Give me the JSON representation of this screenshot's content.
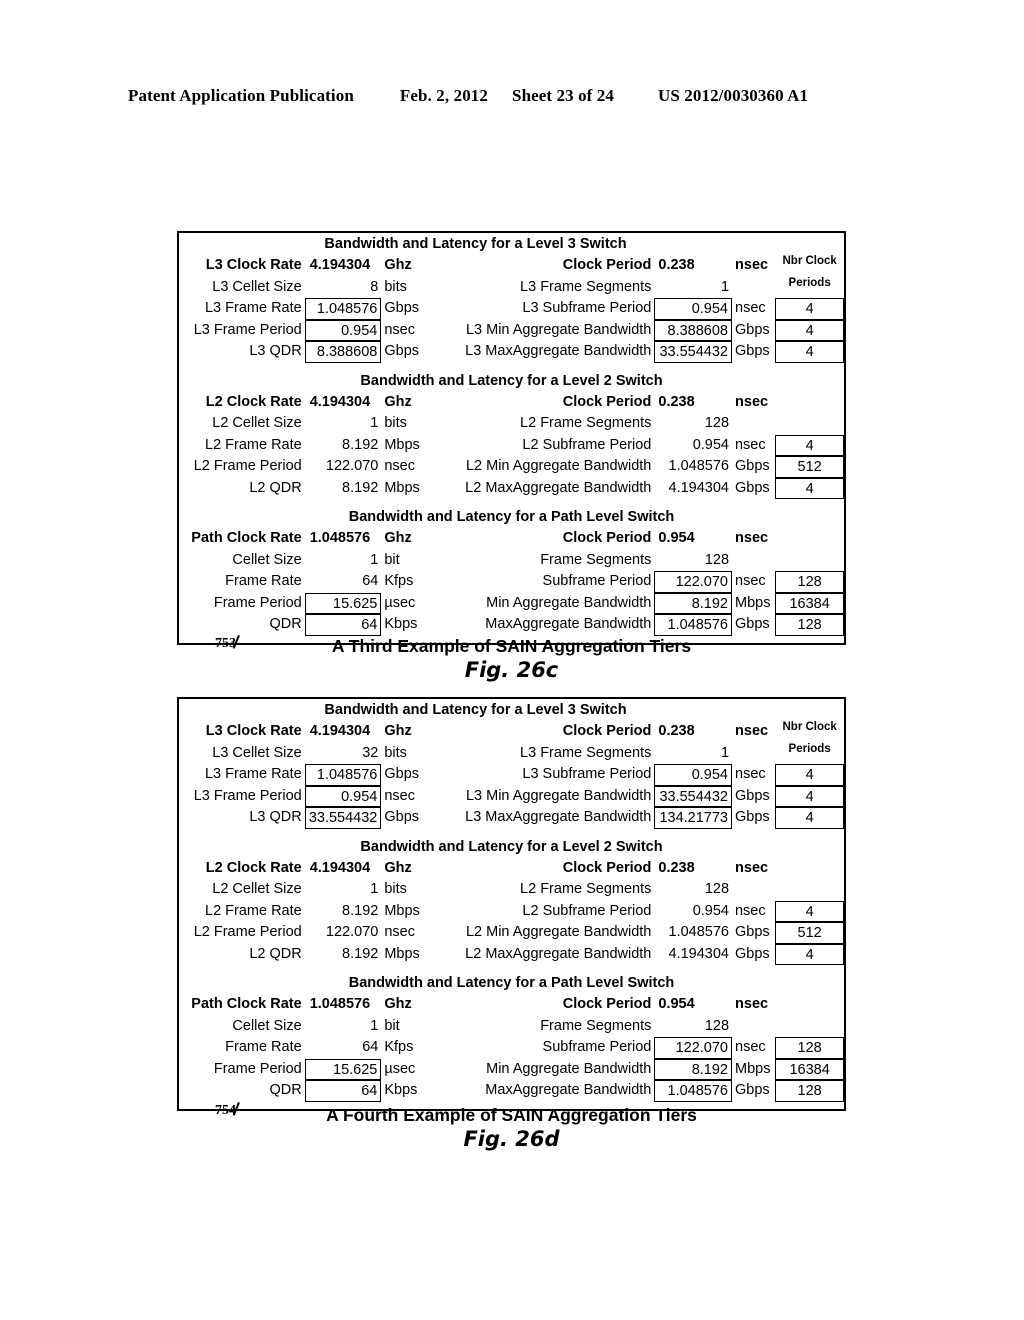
{
  "header": {
    "publication": "Patent Application Publication",
    "date": "Feb. 2, 2012",
    "sheet": "Sheet 23 of 24",
    "number": "US 2012/0030360 A1"
  },
  "nbr_clock_header": {
    "line1": "Nbr Clock",
    "line2": "Periods"
  },
  "figures": [
    {
      "id": "fig-26c",
      "ref_numeral": "753",
      "caption": "A Third Example of SAIN Aggregation Tiers",
      "fig_label": "Fig. 26c",
      "sections": [
        {
          "title": "Bandwidth and Latency for a Level 3 Switch",
          "clock_rate_label": "L3 Clock Rate",
          "clock_rate_value": "4.194304",
          "clock_rate_unit": "Ghz",
          "clock_period_label": "Clock Period",
          "clock_period_value": "0.238",
          "clock_period_unit": "nsec",
          "rows": [
            {
              "left_label": "L3 Cellet Size",
              "left_value": "8",
              "left_unit": "bits",
              "left_boxed": false,
              "right_label": "L3 Frame Segments",
              "right_value": "1",
              "right_unit": "",
              "right_boxed": false,
              "clock": ""
            },
            {
              "left_label": "L3 Frame Rate",
              "left_value": "1.048576",
              "left_unit": "Gbps",
              "left_boxed": true,
              "right_label": "L3 Subframe Period",
              "right_value": "0.954",
              "right_unit": "nsec",
              "right_boxed": true,
              "clock": "4"
            },
            {
              "left_label": "L3 Frame Period",
              "left_value": "0.954",
              "left_unit": "nsec",
              "left_boxed": true,
              "right_label": "L3 Min Aggregate Bandwidth",
              "right_value": "8.388608",
              "right_unit": "Gbps",
              "right_boxed": true,
              "clock": "4"
            },
            {
              "left_label": "L3 QDR",
              "left_value": "8.388608",
              "left_unit": "Gbps",
              "left_boxed": true,
              "right_label": "L3 MaxAggregate Bandwidth",
              "right_value": "33.554432",
              "right_unit": "Gbps",
              "right_boxed": true,
              "clock": "4"
            }
          ]
        },
        {
          "title": "Bandwidth and Latency for a Level 2 Switch",
          "clock_rate_label": "L2 Clock Rate",
          "clock_rate_value": "4.194304",
          "clock_rate_unit": "Ghz",
          "clock_period_label": "Clock Period",
          "clock_period_value": "0.238",
          "clock_period_unit": "nsec",
          "rows": [
            {
              "left_label": "L2 Cellet Size",
              "left_value": "1",
              "left_unit": "bits",
              "left_boxed": false,
              "right_label": "L2 Frame Segments",
              "right_value": "128",
              "right_unit": "",
              "right_boxed": false,
              "clock": ""
            },
            {
              "left_label": "L2 Frame Rate",
              "left_value": "8.192",
              "left_unit": "Mbps",
              "left_boxed": false,
              "right_label": "L2 Subframe Period",
              "right_value": "0.954",
              "right_unit": "nsec",
              "right_boxed": false,
              "clock": "4"
            },
            {
              "left_label": "L2 Frame Period",
              "left_value": "122.070",
              "left_unit": "nsec",
              "left_boxed": false,
              "right_label": "L2 Min Aggregate Bandwidth",
              "right_value": "1.048576",
              "right_unit": "Gbps",
              "right_boxed": false,
              "clock": "512"
            },
            {
              "left_label": "L2 QDR",
              "left_value": "8.192",
              "left_unit": "Mbps",
              "left_boxed": false,
              "right_label": "L2 MaxAggregate Bandwidth",
              "right_value": "4.194304",
              "right_unit": "Gbps",
              "right_boxed": false,
              "clock": "4"
            }
          ]
        },
        {
          "title": "Bandwidth and Latency for a Path Level Switch",
          "clock_rate_label": "Path Clock Rate",
          "clock_rate_value": "1.048576",
          "clock_rate_unit": "Ghz",
          "clock_period_label": "Clock Period",
          "clock_period_value": "0.954",
          "clock_period_unit": "nsec",
          "rows": [
            {
              "left_label": "Cellet Size",
              "left_value": "1",
              "left_unit": "bit",
              "left_boxed": false,
              "right_label": "Frame Segments",
              "right_value": "128",
              "right_unit": "",
              "right_boxed": false,
              "clock": ""
            },
            {
              "left_label": "Frame Rate",
              "left_value": "64",
              "left_unit": "Kfps",
              "left_boxed": false,
              "right_label": "Subframe Period",
              "right_value": "122.070",
              "right_unit": "nsec",
              "right_boxed": true,
              "clock": "128"
            },
            {
              "left_label": "Frame Period",
              "left_value": "15.625",
              "left_unit": "µsec",
              "left_boxed": true,
              "right_label": "Min Aggregate Bandwidth",
              "right_value": "8.192",
              "right_unit": "Mbps",
              "right_boxed": true,
              "clock": "16384"
            },
            {
              "left_label": "QDR",
              "left_value": "64",
              "left_unit": "Kbps",
              "left_boxed": true,
              "right_label": "MaxAggregate Bandwidth",
              "right_value": "1.048576",
              "right_unit": "Gbps",
              "right_boxed": true,
              "clock": "128"
            }
          ]
        }
      ]
    },
    {
      "id": "fig-26d",
      "ref_numeral": "754",
      "caption": "A Fourth Example of SAIN Aggregation Tiers",
      "fig_label": "Fig. 26d",
      "sections": [
        {
          "title": "Bandwidth and Latency for a Level 3 Switch",
          "clock_rate_label": "L3 Clock Rate",
          "clock_rate_value": "4.194304",
          "clock_rate_unit": "Ghz",
          "clock_period_label": "Clock Period",
          "clock_period_value": "0.238",
          "clock_period_unit": "nsec",
          "rows": [
            {
              "left_label": "L3 Cellet Size",
              "left_value": "32",
              "left_unit": "bits",
              "left_boxed": false,
              "right_label": "L3 Frame Segments",
              "right_value": "1",
              "right_unit": "",
              "right_boxed": false,
              "clock": ""
            },
            {
              "left_label": "L3 Frame Rate",
              "left_value": "1.048576",
              "left_unit": "Gbps",
              "left_boxed": true,
              "right_label": "L3 Subframe Period",
              "right_value": "0.954",
              "right_unit": "nsec",
              "right_boxed": true,
              "clock": "4"
            },
            {
              "left_label": "L3 Frame Period",
              "left_value": "0.954",
              "left_unit": "nsec",
              "left_boxed": true,
              "right_label": "L3 Min Aggregate Bandwidth",
              "right_value": "33.554432",
              "right_unit": "Gbps",
              "right_boxed": true,
              "clock": "4"
            },
            {
              "left_label": "L3 QDR",
              "left_value": "33.554432",
              "left_unit": "Gbps",
              "left_boxed": true,
              "right_label": "L3 MaxAggregate Bandwidth",
              "right_value": "134.21773",
              "right_unit": "Gbps",
              "right_boxed": true,
              "clock": "4"
            }
          ]
        },
        {
          "title": "Bandwidth and Latency for a Level 2 Switch",
          "clock_rate_label": "L2 Clock Rate",
          "clock_rate_value": "4.194304",
          "clock_rate_unit": "Ghz",
          "clock_period_label": "Clock Period",
          "clock_period_value": "0.238",
          "clock_period_unit": "nsec",
          "rows": [
            {
              "left_label": "L2 Cellet Size",
              "left_value": "1",
              "left_unit": "bits",
              "left_boxed": false,
              "right_label": "L2 Frame Segments",
              "right_value": "128",
              "right_unit": "",
              "right_boxed": false,
              "clock": ""
            },
            {
              "left_label": "L2 Frame Rate",
              "left_value": "8.192",
              "left_unit": "Mbps",
              "left_boxed": false,
              "right_label": "L2 Subframe Period",
              "right_value": "0.954",
              "right_unit": "nsec",
              "right_boxed": false,
              "clock": "4"
            },
            {
              "left_label": "L2 Frame Period",
              "left_value": "122.070",
              "left_unit": "nsec",
              "left_boxed": false,
              "right_label": "L2 Min Aggregate Bandwidth",
              "right_value": "1.048576",
              "right_unit": "Gbps",
              "right_boxed": false,
              "clock": "512"
            },
            {
              "left_label": "L2 QDR",
              "left_value": "8.192",
              "left_unit": "Mbps",
              "left_boxed": false,
              "right_label": "L2 MaxAggregate Bandwidth",
              "right_value": "4.194304",
              "right_unit": "Gbps",
              "right_boxed": false,
              "clock": "4"
            }
          ]
        },
        {
          "title": "Bandwidth and Latency for a Path Level Switch",
          "clock_rate_label": "Path Clock Rate",
          "clock_rate_value": "1.048576",
          "clock_rate_unit": "Ghz",
          "clock_period_label": "Clock Period",
          "clock_period_value": "0.954",
          "clock_period_unit": "nsec",
          "rows": [
            {
              "left_label": "Cellet Size",
              "left_value": "1",
              "left_unit": "bit",
              "left_boxed": false,
              "right_label": "Frame Segments",
              "right_value": "128",
              "right_unit": "",
              "right_boxed": false,
              "clock": ""
            },
            {
              "left_label": "Frame Rate",
              "left_value": "64",
              "left_unit": "Kfps",
              "left_boxed": false,
              "right_label": "Subframe Period",
              "right_value": "122.070",
              "right_unit": "nsec",
              "right_boxed": true,
              "clock": "128"
            },
            {
              "left_label": "Frame Period",
              "left_value": "15.625",
              "left_unit": "µsec",
              "left_boxed": true,
              "right_label": "Min Aggregate Bandwidth",
              "right_value": "8.192",
              "right_unit": "Mbps",
              "right_boxed": true,
              "clock": "16384"
            },
            {
              "left_label": "QDR",
              "left_value": "64",
              "left_unit": "Kbps",
              "left_boxed": true,
              "right_label": "MaxAggregate Bandwidth",
              "right_value": "1.048576",
              "right_unit": "Gbps",
              "right_boxed": true,
              "clock": "128"
            }
          ]
        }
      ]
    }
  ]
}
